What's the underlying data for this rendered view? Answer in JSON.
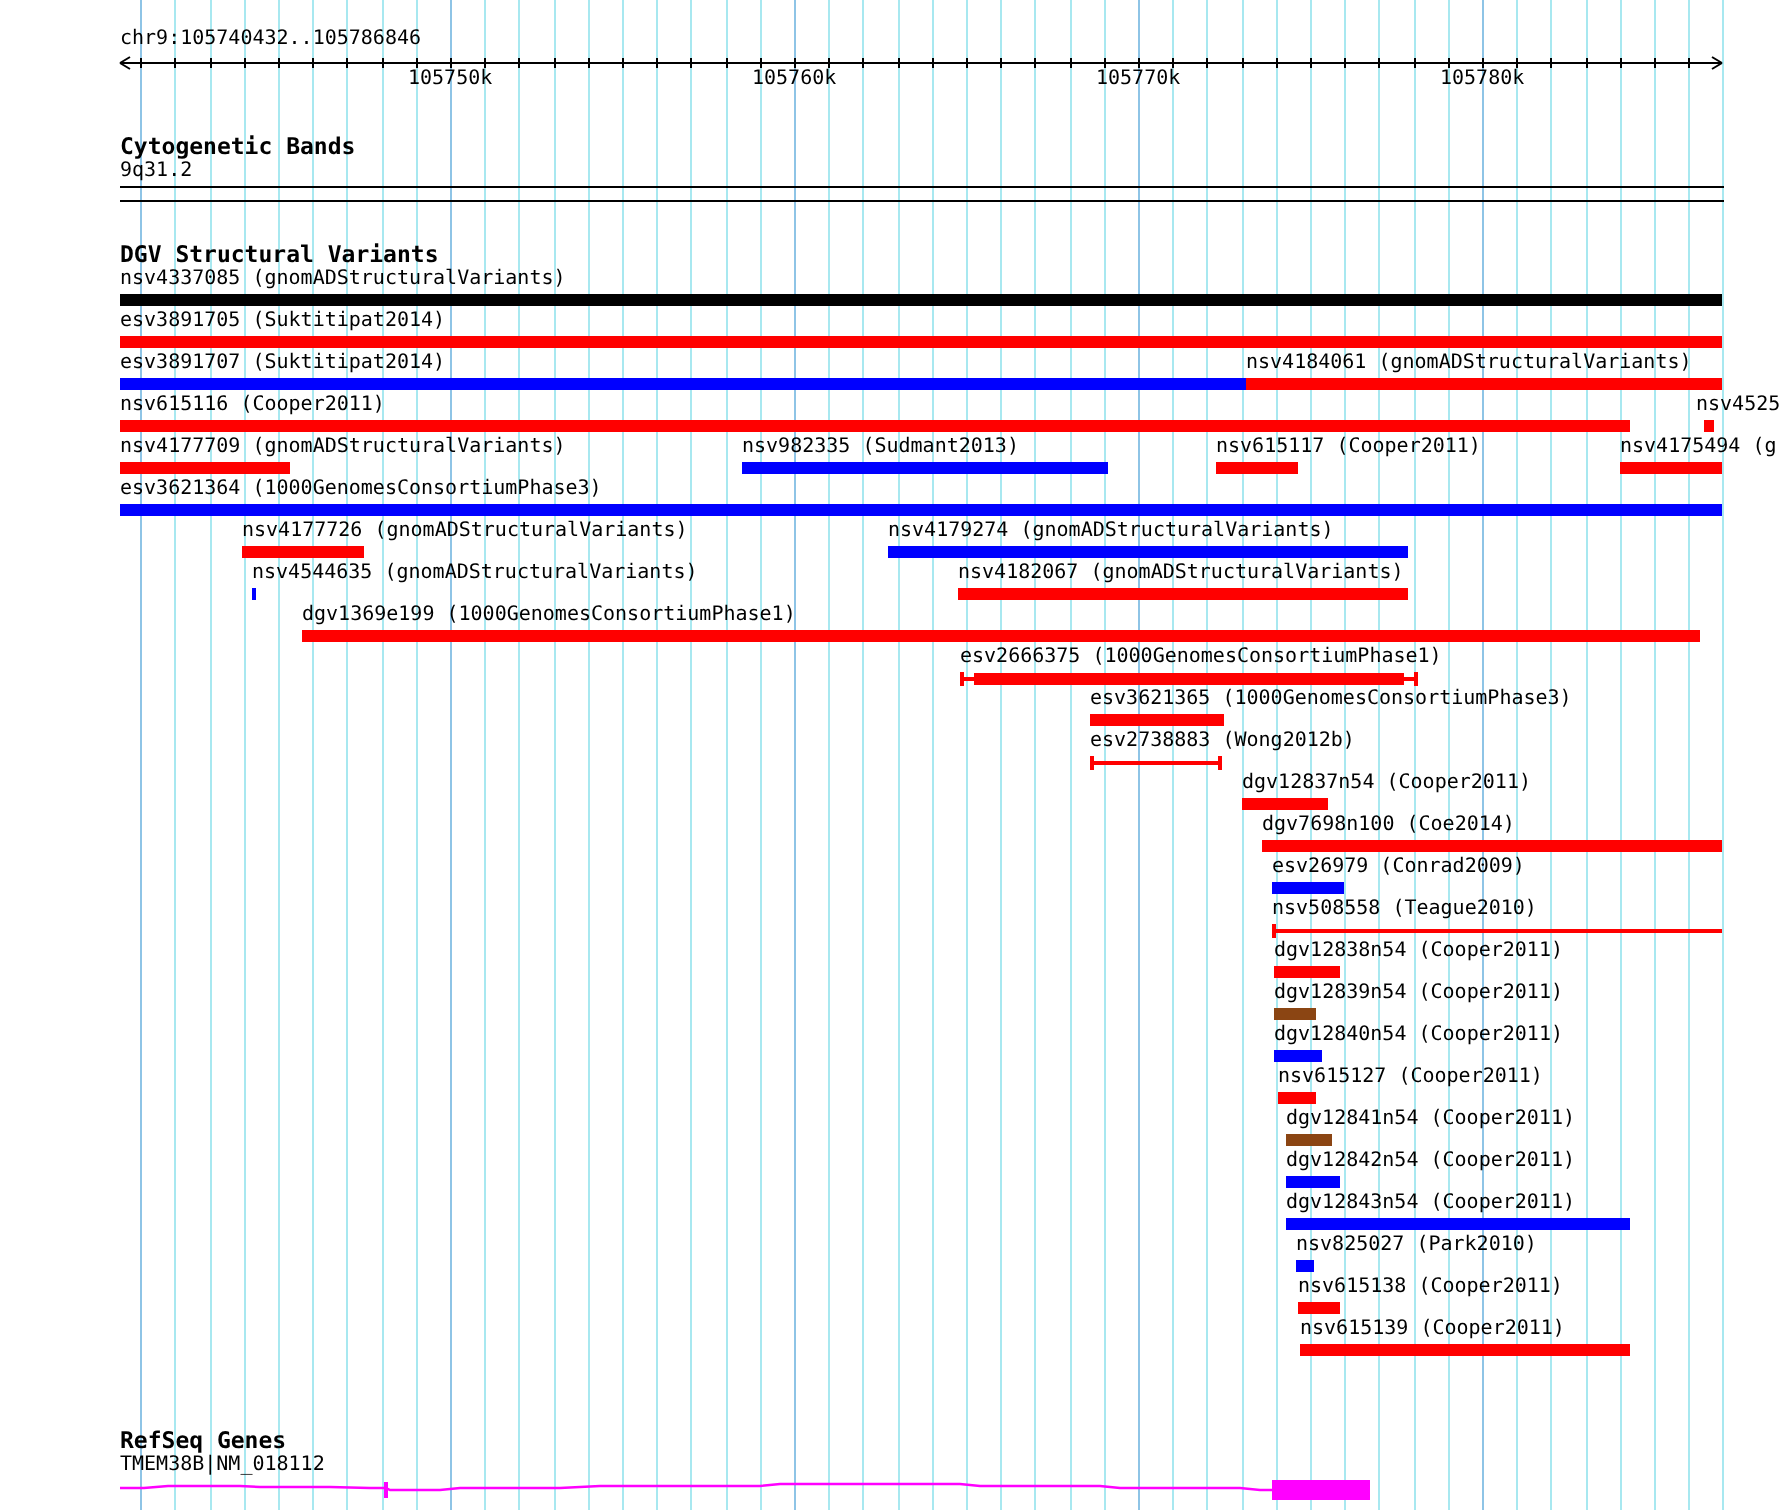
{
  "location": "chr9:105740432..105786846",
  "ruler": {
    "ticks": [
      "105750k",
      "105760k",
      "105770k",
      "105780k"
    ]
  },
  "tracks": [
    {
      "kind": "cytoband",
      "title": "Cytogenetic Bands",
      "band": "9q31.2"
    },
    {
      "kind": "variants",
      "title": "DGV Structural Variants",
      "rows": [
        {
          "features": [
            {
              "label": "nsv4337085 (gnomADStructuralVariants)",
              "color": "#000000",
              "kind": "bar"
            }
          ]
        },
        {
          "features": [
            {
              "label": "esv3891705 (Suktitipat2014)",
              "color": "#ff0000",
              "kind": "bar"
            }
          ]
        },
        {
          "features": [
            {
              "label": "esv3891707 (Suktitipat2014)",
              "color": "#0000ff",
              "kind": "bar"
            },
            {
              "label": "nsv4184061 (gnomADStructuralVariants)",
              "color": "#ff0000",
              "kind": "bar"
            }
          ]
        },
        {
          "features": [
            {
              "label": "nsv615116 (Cooper2011)",
              "color": "#ff0000",
              "kind": "bar"
            },
            {
              "label": "nsv4525",
              "color": "#ff0000",
              "kind": "bar"
            }
          ]
        },
        {
          "features": [
            {
              "label": "nsv4177709 (gnomADStructuralVariants)",
              "color": "#ff0000",
              "kind": "bar"
            },
            {
              "label": "nsv982335 (Sudmant2013)",
              "color": "#0000ff",
              "kind": "bar"
            },
            {
              "label": "nsv615117 (Cooper2011)",
              "color": "#ff0000",
              "kind": "bar"
            },
            {
              "label": "nsv4175494 (g",
              "color": "#ff0000",
              "kind": "bar"
            }
          ]
        },
        {
          "features": [
            {
              "label": "esv3621364 (1000GenomesConsortiumPhase3)",
              "color": "#0000ff",
              "kind": "bar"
            }
          ]
        },
        {
          "features": [
            {
              "label": "nsv4177726 (gnomADStructuralVariants)",
              "color": "#ff0000",
              "kind": "bar"
            },
            {
              "label": "nsv4179274 (gnomADStructuralVariants)",
              "color": "#0000ff",
              "kind": "bar"
            }
          ]
        },
        {
          "features": [
            {
              "label": "nsv4544635 (gnomADStructuralVariants)",
              "color": "#0000ff",
              "kind": "bar"
            },
            {
              "label": "nsv4182067 (gnomADStructuralVariants)",
              "color": "#ff0000",
              "kind": "bar"
            }
          ]
        },
        {
          "features": [
            {
              "label": "dgv1369e199 (1000GenomesConsortiumPhase1)",
              "color": "#ff0000",
              "kind": "bar"
            }
          ]
        },
        {
          "features": [
            {
              "label": "esv2666375 (1000GenomesConsortiumPhase1)",
              "color": "#ff0000",
              "kind": "bracketed_bar"
            }
          ]
        },
        {
          "features": [
            {
              "label": "esv3621365 (1000GenomesConsortiumPhase3)",
              "color": "#ff0000",
              "kind": "bar"
            }
          ]
        },
        {
          "features": [
            {
              "label": "esv2738883 (Wong2012b)",
              "color": "#ff0000",
              "kind": "bracketed_line"
            }
          ]
        },
        {
          "features": [
            {
              "label": "dgv12837n54 (Cooper2011)",
              "color": "#ff0000",
              "kind": "bar"
            }
          ]
        },
        {
          "features": [
            {
              "label": "dgv7698n100 (Coe2014)",
              "color": "#ff0000",
              "kind": "bar"
            }
          ]
        },
        {
          "features": [
            {
              "label": "esv26979 (Conrad2009)",
              "color": "#0000ff",
              "kind": "bar"
            }
          ]
        },
        {
          "features": [
            {
              "label": "nsv508558 (Teague2010)",
              "color": "#ff0000",
              "kind": "open_line"
            }
          ]
        },
        {
          "features": [
            {
              "label": "dgv12838n54 (Cooper2011)",
              "color": "#ff0000",
              "kind": "bar"
            }
          ]
        },
        {
          "features": [
            {
              "label": "dgv12839n54 (Cooper2011)",
              "color": "#8b4513",
              "kind": "bar"
            }
          ]
        },
        {
          "features": [
            {
              "label": "dgv12840n54 (Cooper2011)",
              "color": "#0000ff",
              "kind": "bar"
            }
          ]
        },
        {
          "features": [
            {
              "label": "nsv615127 (Cooper2011)",
              "color": "#ff0000",
              "kind": "bar"
            }
          ]
        },
        {
          "features": [
            {
              "label": "dgv12841n54 (Cooper2011)",
              "color": "#8b4513",
              "kind": "bar"
            }
          ]
        },
        {
          "features": [
            {
              "label": "dgv12842n54 (Cooper2011)",
              "color": "#0000ff",
              "kind": "bar"
            }
          ]
        },
        {
          "features": [
            {
              "label": "dgv12843n54 (Cooper2011)",
              "color": "#0000ff",
              "kind": "bar"
            }
          ]
        },
        {
          "features": [
            {
              "label": "nsv825027 (Park2010)",
              "color": "#0000ff",
              "kind": "bar"
            }
          ]
        },
        {
          "features": [
            {
              "label": "nsv615138 (Cooper2011)",
              "color": "#ff0000",
              "kind": "bar"
            }
          ]
        },
        {
          "features": [
            {
              "label": "nsv615139 (Cooper2011)",
              "color": "#ff0000",
              "kind": "bar"
            }
          ]
        }
      ]
    },
    {
      "kind": "gene",
      "title": "RefSeq Genes",
      "gene": "TMEM38B|NM_018112"
    }
  ]
}
